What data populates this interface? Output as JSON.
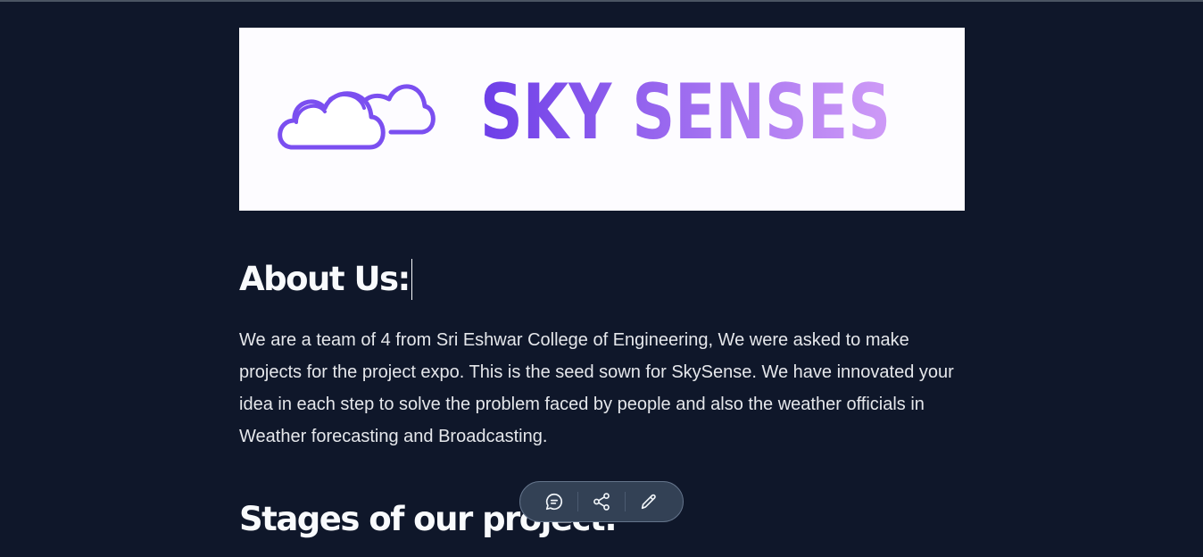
{
  "banner": {
    "brand_text": "SKY SENSES",
    "colors": {
      "gradient_start": "#6d3ee8",
      "gradient_end": "#cf9bf7",
      "cloud_stroke": "#7b4ff0",
      "background": "#fdfcff"
    }
  },
  "about": {
    "heading": "About Us:",
    "body": "We are a team of 4 from Sri Eshwar College of Engineering, We were asked to make projects for the project expo. This is the seed sown for SkySense. We have innovated your idea in each step to solve the problem faced by people and also the weather officials in Weather forecasting and Broadcasting."
  },
  "stages": {
    "heading": "Stages of our project:"
  },
  "toolbar": {
    "icons": [
      "comment-icon",
      "share-icon",
      "edit-pencil-icon"
    ]
  },
  "theme": {
    "page_background": "#0f172a",
    "text": "#f1f5f9",
    "toolbar_background": "#334155"
  }
}
